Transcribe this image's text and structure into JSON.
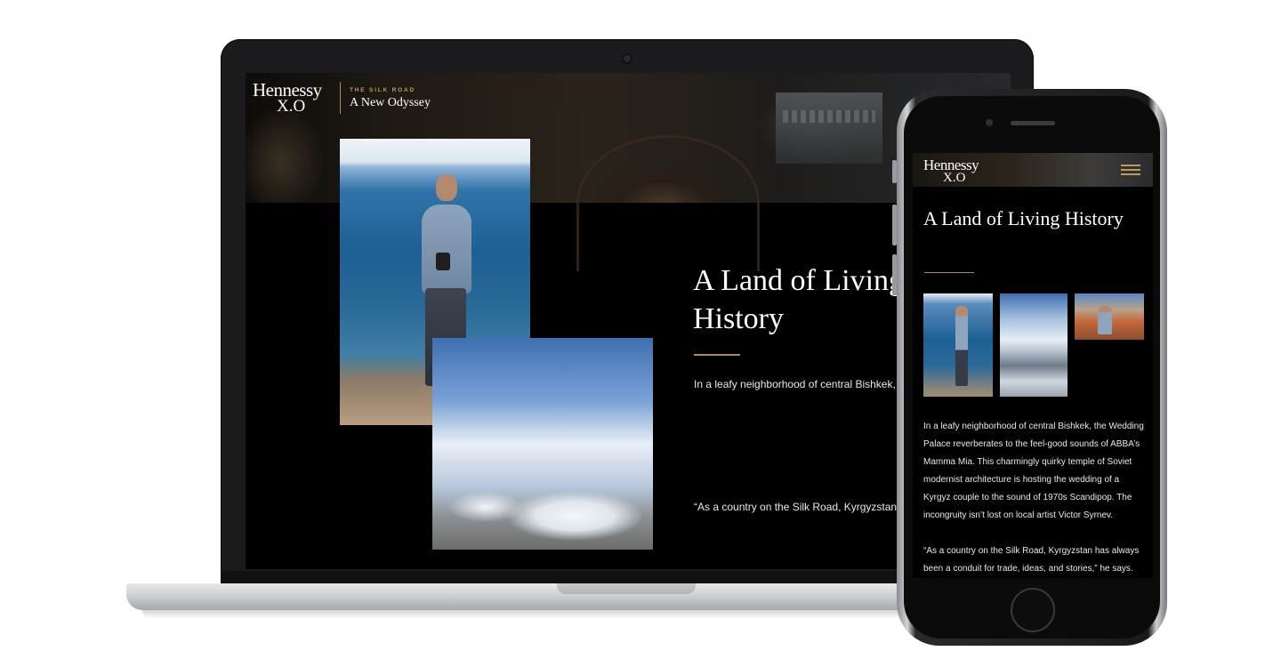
{
  "brand": {
    "name": "Hennessy",
    "edition": "X.O",
    "kicker": "THE SILK ROAD",
    "subtitle": "A New Odyssey"
  },
  "article": {
    "title": "A Land of Living History",
    "desktop_paragraph_1": "In a leafy neighborhood of central Bishkek, th\nreverberates to the feel-good sounds of ABBA\nThis charmingly quirky temple of Soviet mod\nis hosting the wedding of a Kyrgyz couple to\nScandipop. The incongruity isn’t lost on local",
    "desktop_paragraph_2": "“As a country on the Silk Road, Kyrgyzstan ha\nconduit for trade, ideas, and stories,” he says\ninterested in the juxtaposition of old and new",
    "mobile_paragraph_1": "In a leafy neighborhood of central Bishkek, the Wedding Palace reverberates to the feel-good sounds of ABBA’s Mamma Mia. This charmingly quirky temple of Soviet modernist architecture is hosting the wedding of a Kyrgyz couple to the sound of 1970s Scandipop. The incongruity isn’t lost on local artist Victor Syrnev.",
    "mobile_paragraph_2": "“As a country on the Silk Road, Kyrgyzstan has always been a conduit for trade, ideas, and stories,” he says. “I’m"
  },
  "icons": {
    "menu": "hamburger-menu-icon"
  },
  "colors": {
    "accent_gold": "#b08a52",
    "background": "#000000",
    "text": "#ffffff"
  }
}
